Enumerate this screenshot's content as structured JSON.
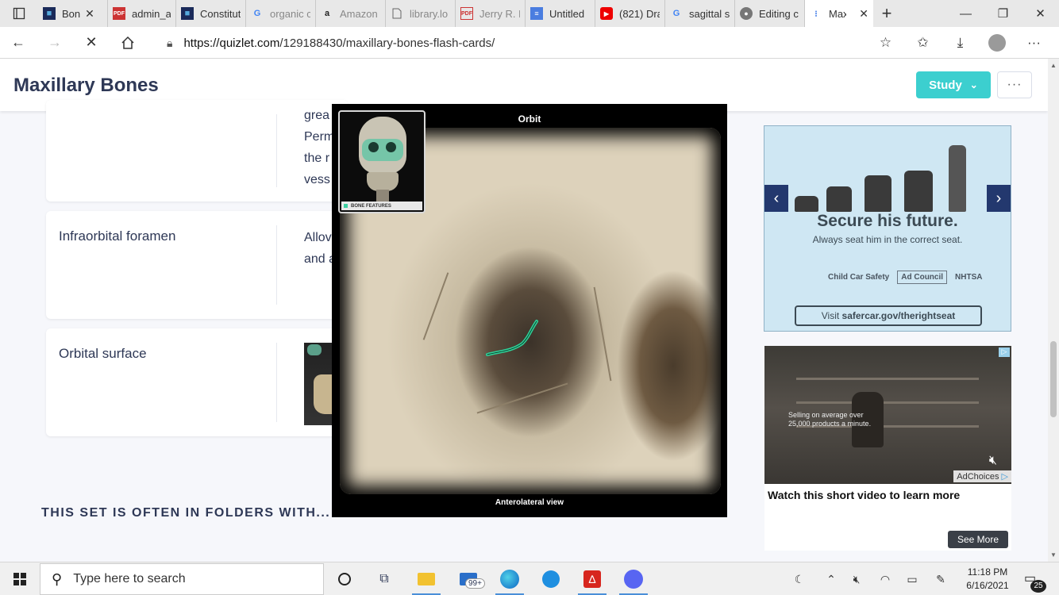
{
  "browser": {
    "tabs": [
      {
        "label": "Bon",
        "icon": "quizlet-favicon-icon",
        "close": "✕"
      },
      {
        "label": "admin_ar",
        "icon": "pdf-favicon-icon"
      },
      {
        "label": "Constitut",
        "icon": "quizlet-favicon-icon"
      },
      {
        "label": "organic c",
        "icon": "google-favicon-icon"
      },
      {
        "label": "Amazon",
        "icon": "amazon-favicon-icon"
      },
      {
        "label": "library.lo",
        "icon": "document-favicon-icon"
      },
      {
        "label": "Jerry R. N",
        "icon": "pdf-favicon-icon"
      },
      {
        "label": "Untitled",
        "icon": "google-docs-favicon-icon"
      },
      {
        "label": "(821) Dra",
        "icon": "youtube-favicon-icon"
      },
      {
        "label": "sagittal s",
        "icon": "google-favicon-icon"
      },
      {
        "label": "Editing c",
        "icon": "reddit-favicon-icon"
      },
      {
        "label": "Max",
        "icon": "loading-icon",
        "close": "✕",
        "active": true
      }
    ],
    "new_tab": "+",
    "address": {
      "host": "https://quizlet.com",
      "path": "/129188430/maxillary-bones-flash-cards/"
    }
  },
  "page": {
    "title": "Maxillary Bones",
    "study_button": "Study",
    "more_button": "···",
    "cards": [
      {
        "term": "",
        "definition_lines": [
          "grea",
          "Perm",
          "the r",
          "vess"
        ]
      },
      {
        "term": "Infraorbital foramen",
        "definition_lines": [
          "Allov",
          "and a"
        ]
      },
      {
        "term": "Orbital surface",
        "definition_lines": []
      }
    ],
    "folders_heading": "THIS SET IS OFTEN IN FOLDERS WITH..."
  },
  "image_modal": {
    "title": "Orbit",
    "caption": "Anterolateral view",
    "inset_label": "BONE FEATURES",
    "highlight_color": "#2fd39a"
  },
  "ads": {
    "car_seat": {
      "headline": "Secure his future.",
      "subline": "Always seat him in the correct seat.",
      "logos": [
        "Child Car Safety",
        "Ad Council",
        "NHTSA"
      ],
      "cta_prefix": "Visit ",
      "cta_link": "safercar.gov/therightseat"
    },
    "video": {
      "overlay_text": "Selling on average over 25,000 products a minute.",
      "adchoices": "AdChoices",
      "caption": "Watch this short video to learn more",
      "button": "See More"
    }
  },
  "taskbar": {
    "search_placeholder": "Type here to search",
    "mail_badge": "99+",
    "time": "11:18 PM",
    "date": "6/16/2021",
    "notification_count": "25"
  },
  "colors": {
    "study_button": "#3ccfcf",
    "ad_background": "#cfe7f3",
    "ad_arrow": "#23386e"
  }
}
